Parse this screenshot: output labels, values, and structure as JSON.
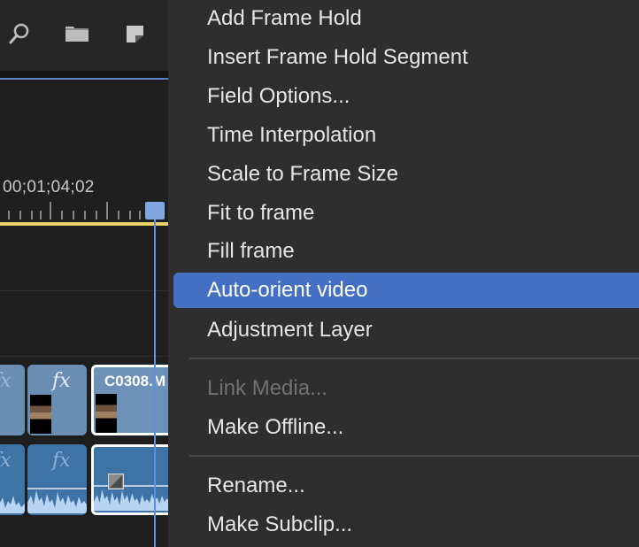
{
  "timeline": {
    "timecode": "00;01;04;02",
    "video_clip_label": "C0308.M",
    "fx_label": "fx",
    "icons": [
      "search-icon",
      "folder-icon",
      "sticky-note-icon"
    ],
    "colors": {
      "playhead": "#5f8fdb",
      "work_area_bar": "#e6d46a",
      "video_clip": "#6a8db3",
      "audio_clip": "#3e73a6"
    }
  },
  "menu": {
    "items": [
      {
        "label": "Add Frame Hold",
        "state": "normal"
      },
      {
        "label": "Insert Frame Hold Segment",
        "state": "normal"
      },
      {
        "label": "Field Options...",
        "state": "normal"
      },
      {
        "label": "Time Interpolation",
        "state": "normal"
      },
      {
        "label": "Scale to Frame Size",
        "state": "normal"
      },
      {
        "label": "Fit to frame",
        "state": "normal"
      },
      {
        "label": "Fill frame",
        "state": "normal"
      },
      {
        "label": "Auto-orient video",
        "state": "highlighted"
      },
      {
        "label": "Adjustment Layer",
        "state": "normal"
      },
      {
        "label": "Link Media...",
        "state": "disabled"
      },
      {
        "label": "Make Offline...",
        "state": "normal"
      },
      {
        "label": "Rename...",
        "state": "normal"
      },
      {
        "label": "Make Subclip...",
        "state": "normal"
      }
    ],
    "colors": {
      "background": "#2e2e2e",
      "highlight": "#4470c4",
      "text": "#e6e6e6",
      "disabled_text": "#727272"
    }
  }
}
